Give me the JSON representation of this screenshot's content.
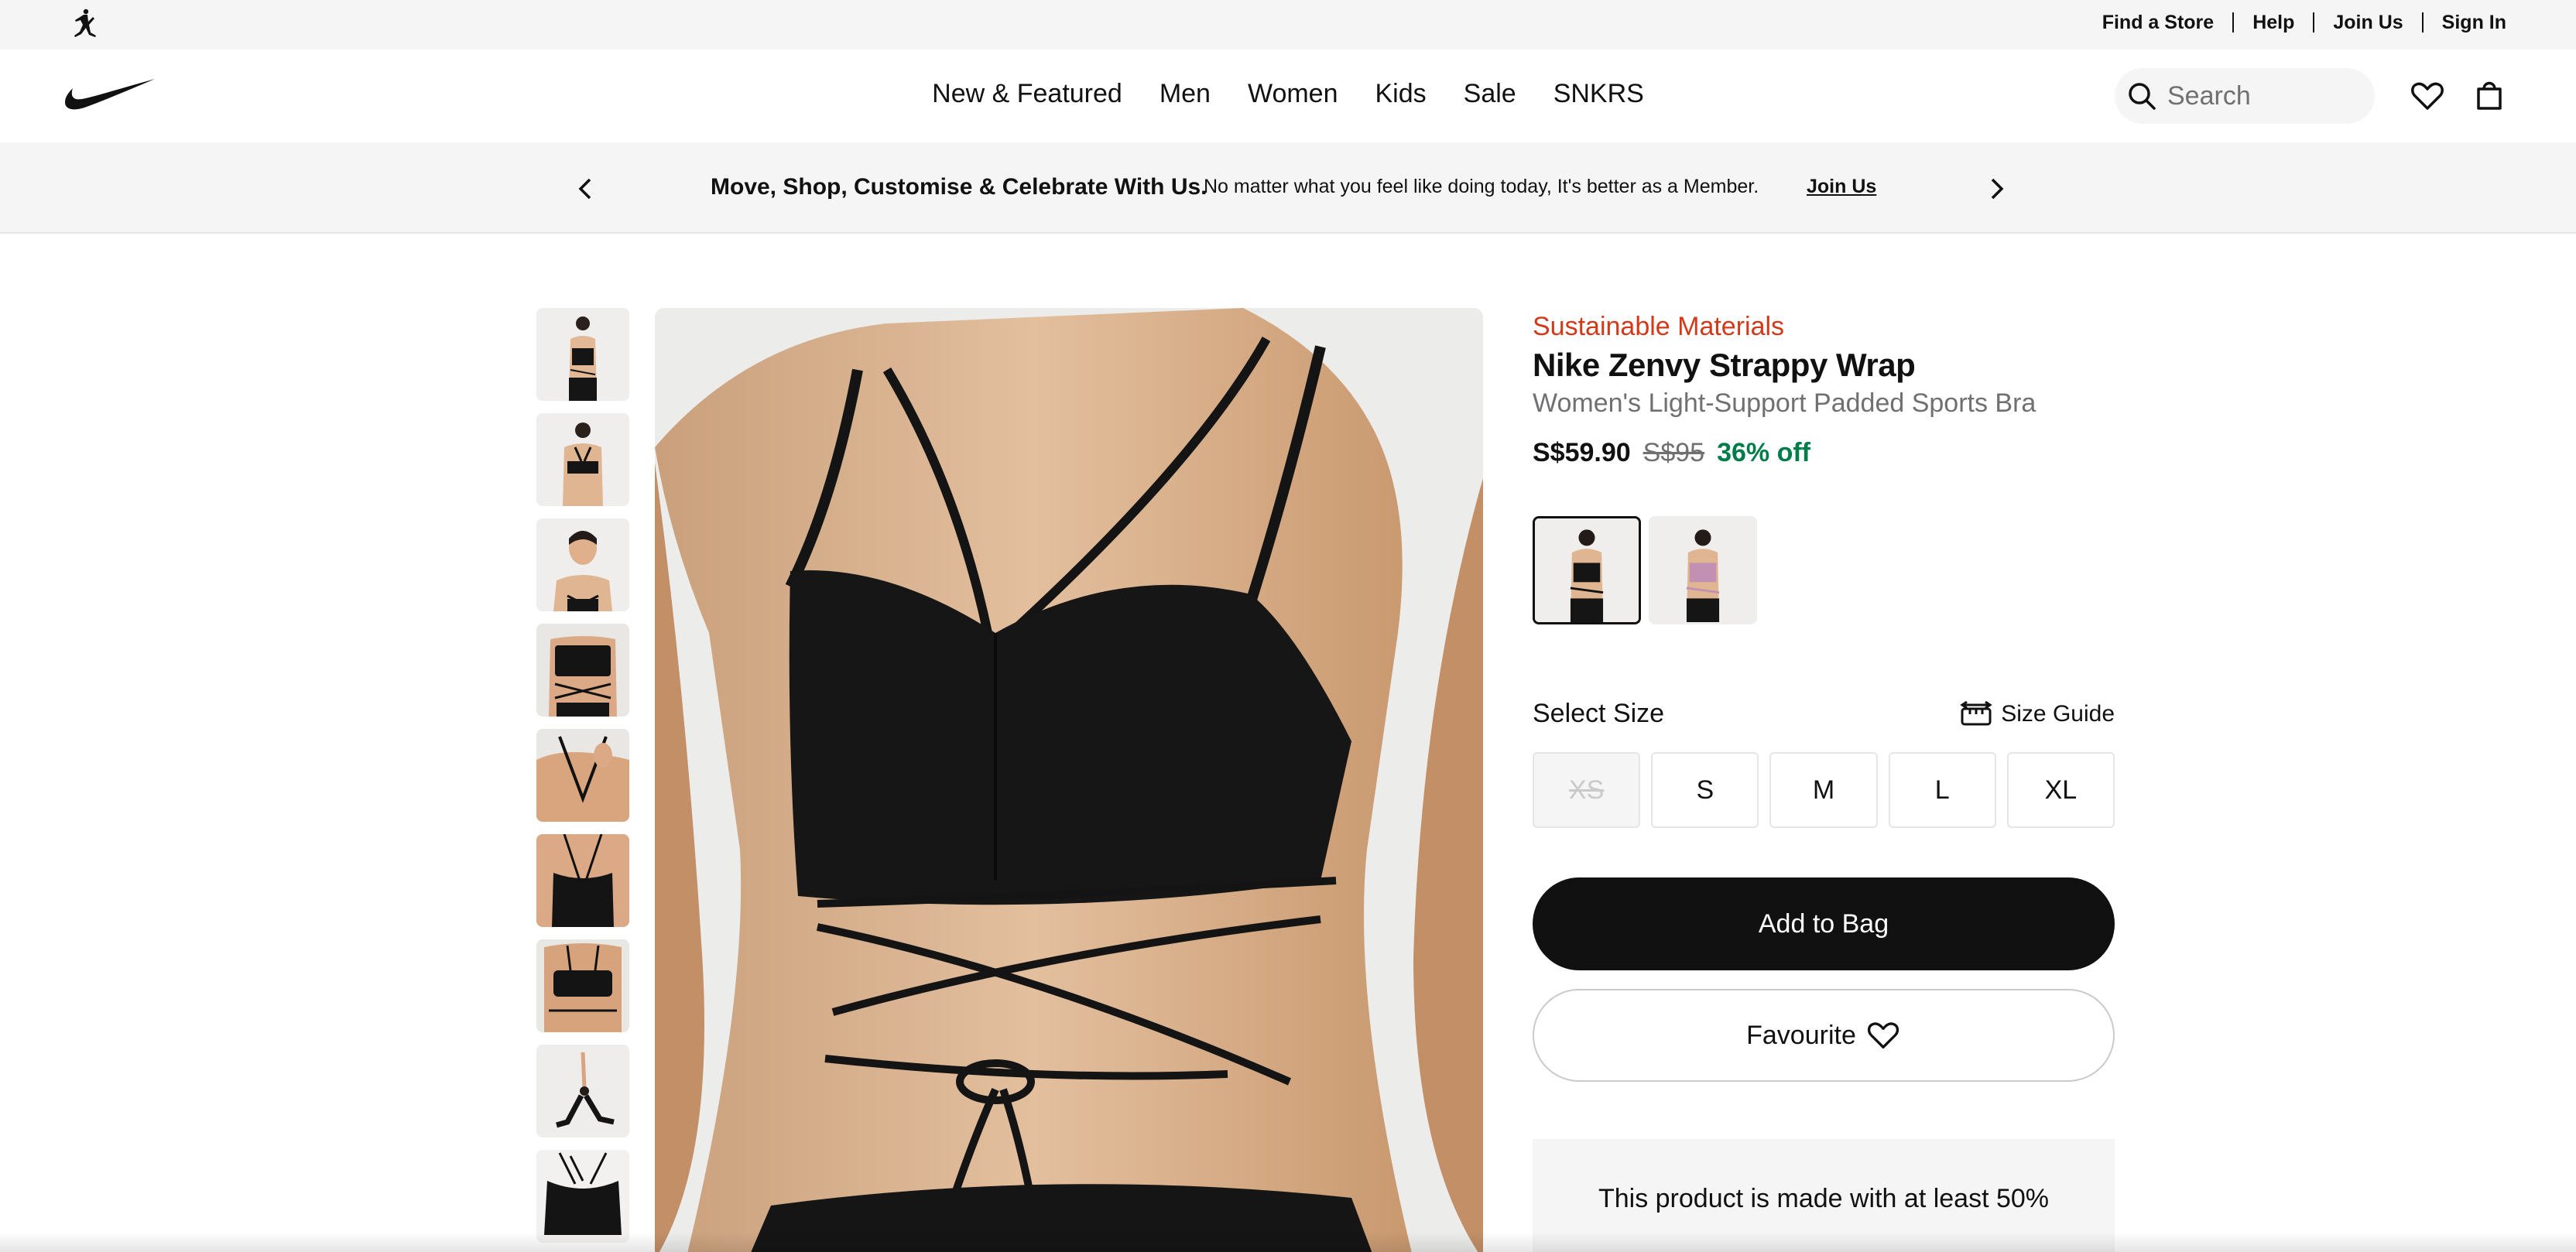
{
  "utility_bar": {
    "links": [
      "Find a Store",
      "Help",
      "Join Us",
      "Sign In"
    ]
  },
  "header": {
    "nav": [
      "New & Featured",
      "Men",
      "Women",
      "Kids",
      "Sale",
      "SNKRS"
    ],
    "search_placeholder": "Search"
  },
  "promo": {
    "heading": "Move, Shop, Customise & Celebrate With Us.",
    "text": "No matter what you feel like doing today, It's better as a Member.",
    "link": "Join Us"
  },
  "product": {
    "badge": "Sustainable Materials",
    "title": "Nike Zenvy Strappy Wrap",
    "subtitle": "Women's Light-Support Padded Sports Bra",
    "price_current": "S$59.90",
    "price_original": "S$95",
    "discount": "36% off",
    "colorways_count": 2,
    "select_size_label": "Select Size",
    "size_guide_label": "Size Guide",
    "sizes": [
      {
        "label": "XS",
        "available": false
      },
      {
        "label": "S",
        "available": true
      },
      {
        "label": "M",
        "available": true
      },
      {
        "label": "L",
        "available": true
      },
      {
        "label": "XL",
        "available": true
      }
    ],
    "add_to_bag_label": "Add to Bag",
    "favourite_label": "Favourite",
    "sustainability_text": "This product is made with at least 50%"
  },
  "colors": {
    "brand_black": "#111111",
    "sale_green": "#007d48",
    "sustainable_red": "#d33918",
    "muted_gray": "#707072"
  },
  "gallery": {
    "thumbnail_count": 9
  }
}
